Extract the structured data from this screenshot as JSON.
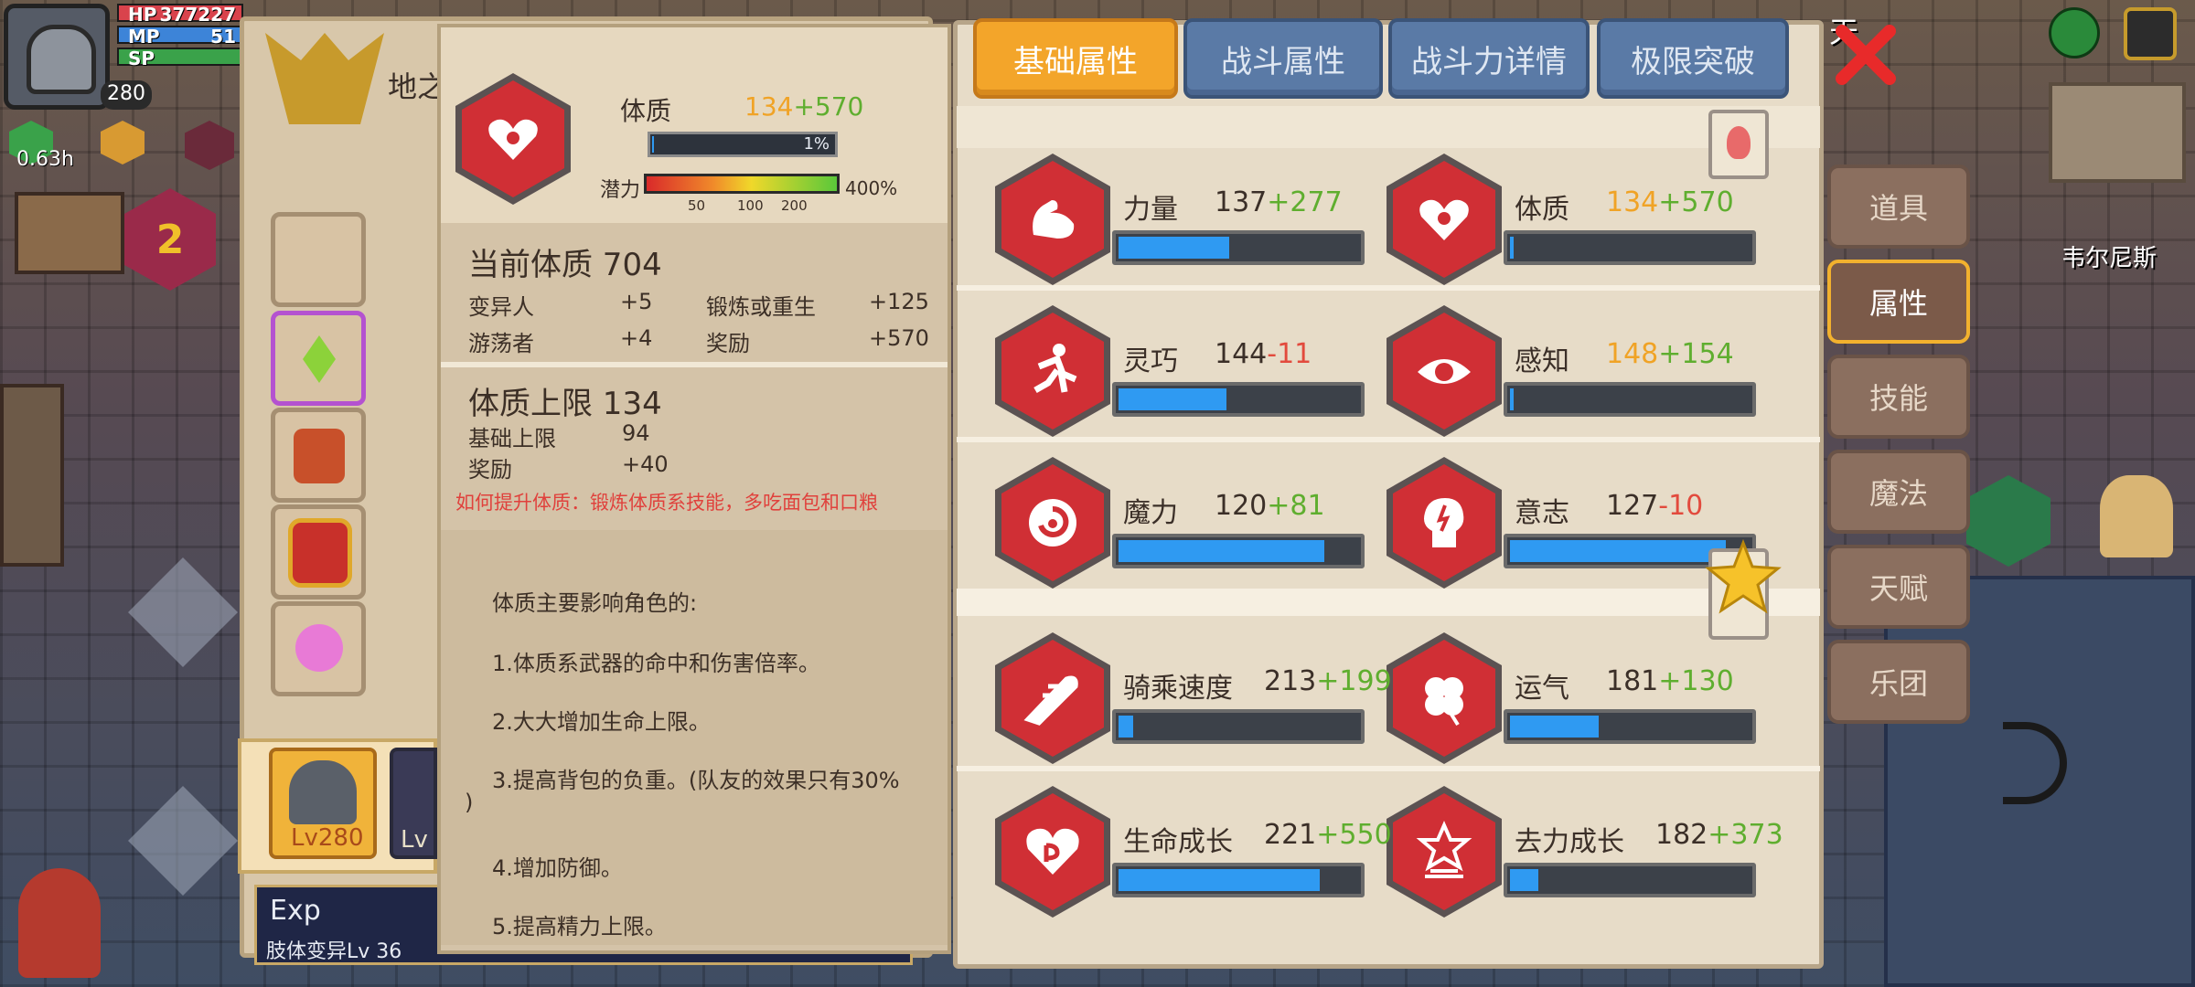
{
  "hud": {
    "hp_label": "HP",
    "hp_value": "377227",
    "mp_label": "MP",
    "mp_value": "51",
    "sp_label": "SP",
    "level": "280",
    "timer": "0.63h",
    "dungeon_level": "2",
    "player_title": "地之",
    "location": "韦尔尼斯",
    "top_right_text": "天"
  },
  "hero_card": {
    "level": "Lv280",
    "second_level": "Lv"
  },
  "exp_bar": {
    "label": "Exp",
    "sub": "肢体变异Lv 36"
  },
  "detail": {
    "stat_name": "体质",
    "base": "134",
    "bonus": "+570",
    "progress_pct": "1%",
    "potential_label": "潜力",
    "potential_ticks": [
      "50",
      "100",
      "200"
    ],
    "potential_pct": "400%",
    "current_title": "当前体质 704",
    "sources": [
      {
        "name": "变异人",
        "value": "+5"
      },
      {
        "name": "锻炼或重生",
        "value": "+125"
      },
      {
        "name": "游荡者",
        "value": "+4"
      },
      {
        "name": "奖励",
        "value": "+570"
      }
    ],
    "limit_title": "体质上限 134",
    "limit_rows": [
      {
        "name": "基础上限",
        "value": "94"
      },
      {
        "name": "奖励",
        "value": "+40"
      }
    ],
    "hint": "如何提升体质：锻炼体质系技能，多吃面包和口粮",
    "effects_title": "体质主要影响角色的:",
    "effects": [
      "1.体质系武器的命中和伤害倍率。",
      "2.大大增加生命上限。",
      "3.提高背包的负重。(队友的效果只有30%",
      ")",
      "4.增加防御。",
      "5.提高精力上限。"
    ]
  },
  "tabs": [
    {
      "label": "基础属性",
      "active": true
    },
    {
      "label": "战斗属性",
      "active": false
    },
    {
      "label": "战斗力详情",
      "active": false
    },
    {
      "label": "极限突破",
      "active": false
    }
  ],
  "attributes": [
    {
      "name": "力量",
      "base": "137",
      "mod": "+277",
      "mod_color": "green",
      "fill": 0.46,
      "base_color": "normal"
    },
    {
      "name": "体质",
      "base": "134",
      "mod": "+570",
      "mod_color": "green",
      "fill": 0.01,
      "base_color": "orange"
    },
    {
      "name": "灵巧",
      "base": "144",
      "mod": "-11",
      "mod_color": "red",
      "fill": 0.45,
      "base_color": "normal"
    },
    {
      "name": "感知",
      "base": "148",
      "mod": "+154",
      "mod_color": "green",
      "fill": 0.01,
      "base_color": "orange"
    },
    {
      "name": "魔力",
      "base": "120",
      "mod": "+81",
      "mod_color": "green",
      "fill": 0.86,
      "base_color": "normal"
    },
    {
      "name": "意志",
      "base": "127",
      "mod": "-10",
      "mod_color": "red",
      "fill": 0.9,
      "base_color": "normal"
    },
    {
      "name": "骑乘速度",
      "base": "213",
      "mod": "+199",
      "mod_color": "green",
      "fill": 0.06,
      "base_color": "normal"
    },
    {
      "name": "运气",
      "base": "181",
      "mod": "+130",
      "mod_color": "green",
      "fill": 0.37,
      "base_color": "normal"
    },
    {
      "name": "生命成长",
      "base": "221",
      "mod": "+550",
      "mod_color": "green",
      "fill": 0.84,
      "base_color": "normal"
    },
    {
      "name": "去力成长",
      "base": "182",
      "mod": "+373",
      "mod_color": "green",
      "fill": 0.12,
      "base_color": "normal"
    }
  ],
  "side_menu": [
    {
      "label": "道具",
      "active": false
    },
    {
      "label": "属性",
      "active": true
    },
    {
      "label": "技能",
      "active": false
    },
    {
      "label": "魔法",
      "active": false
    },
    {
      "label": "天赋",
      "active": false
    },
    {
      "label": "乐团",
      "active": false
    }
  ],
  "colors": {
    "accent": "#f3a52a",
    "bar": "#2f9af2",
    "stat_red": "#d02f35",
    "green": "#5fae2f",
    "orange": "#f0a326",
    "red": "#e24a3d"
  }
}
